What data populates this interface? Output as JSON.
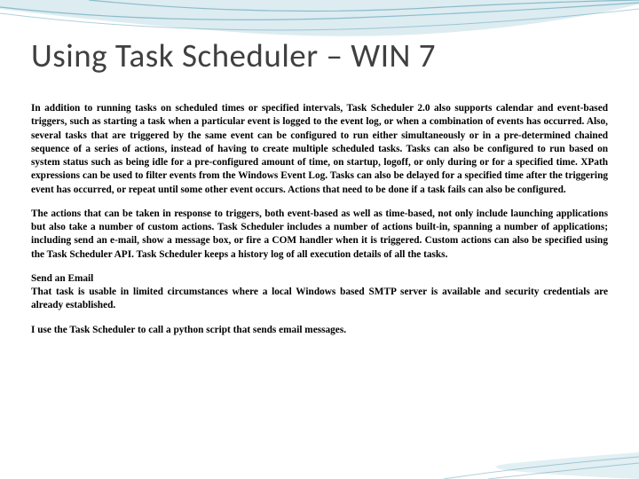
{
  "slide": {
    "title": "Using Task Scheduler – WIN 7",
    "paragraph1": "In addition to running tasks on scheduled times or specified intervals, Task Scheduler 2.0 also supports calendar and event-based triggers, such as starting a task when a particular event is logged to the event log, or when a combination of events has occurred. Also, several tasks that are triggered by the same event can be configured to run either simultaneously or in a pre-determined chained sequence of a series of actions, instead of having to create multiple scheduled tasks. Tasks can also be configured to run based on system status such as being idle for a pre-configured amount of time, on startup, logoff, or only during or for a specified time. XPath expressions can be used to filter events from the Windows Event Log. Tasks can also be delayed for a specified time after the triggering event has occurred, or repeat until some other event occurs. Actions that need to be done if a task fails can also be configured.",
    "paragraph2": "The actions that can be taken in response to triggers, both event-based as well as time-based, not only include launching applications but also take a number of custom actions. Task Scheduler includes a number of actions built-in, spanning a number of applications; including send an e-mail, show a message box, or fire a COM handler when it is triggered. Custom actions can also be specified using the Task Scheduler API. Task Scheduler keeps a history log of all execution details of all the tasks.",
    "paragraph3": "Send an Email\nThat task is usable in limited circumstances where a local Windows based SMTP server is available and security credentials are already established.",
    "paragraph4": "I use the Task Scheduler to call a python script that sends email messages."
  }
}
